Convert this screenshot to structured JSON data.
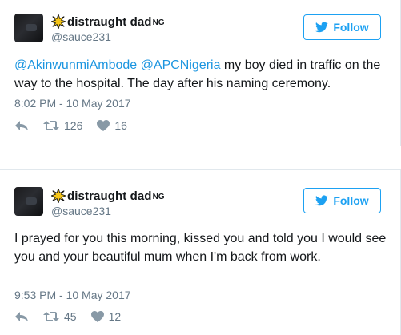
{
  "tweets": [
    {
      "display_name": "distraught dad",
      "name_suffix": "NG",
      "handle": "@sauce231",
      "follow_label": "Follow",
      "mention_1": "@AkinwunmiAmbode",
      "mention_2": "@APCNigeria",
      "text_rest": " my boy died in traffic on the way to the hospital. The day after his naming ceremony.",
      "timestamp": "8:02 PM - 10 May 2017",
      "retweets": "126",
      "likes": "16"
    },
    {
      "display_name": "distraught dad",
      "name_suffix": "NG",
      "handle": "@sauce231",
      "follow_label": "Follow",
      "text": "I prayed for you this morning, kissed you and told you I would see you and your beautiful mum when I'm back from work.",
      "timestamp": "9:53 PM - 10 May 2017",
      "retweets": "45",
      "likes": "12"
    }
  ],
  "colors": {
    "link": "#1b95e0",
    "follow": "#1da1f2",
    "muted": "#657786",
    "text": "#14171a",
    "star": "#f5c518"
  },
  "icons": {
    "name_badge": "star-burst-icon",
    "follow": "twitter-bird-icon",
    "reply": "reply-icon",
    "retweet": "retweet-icon",
    "like": "heart-icon"
  }
}
